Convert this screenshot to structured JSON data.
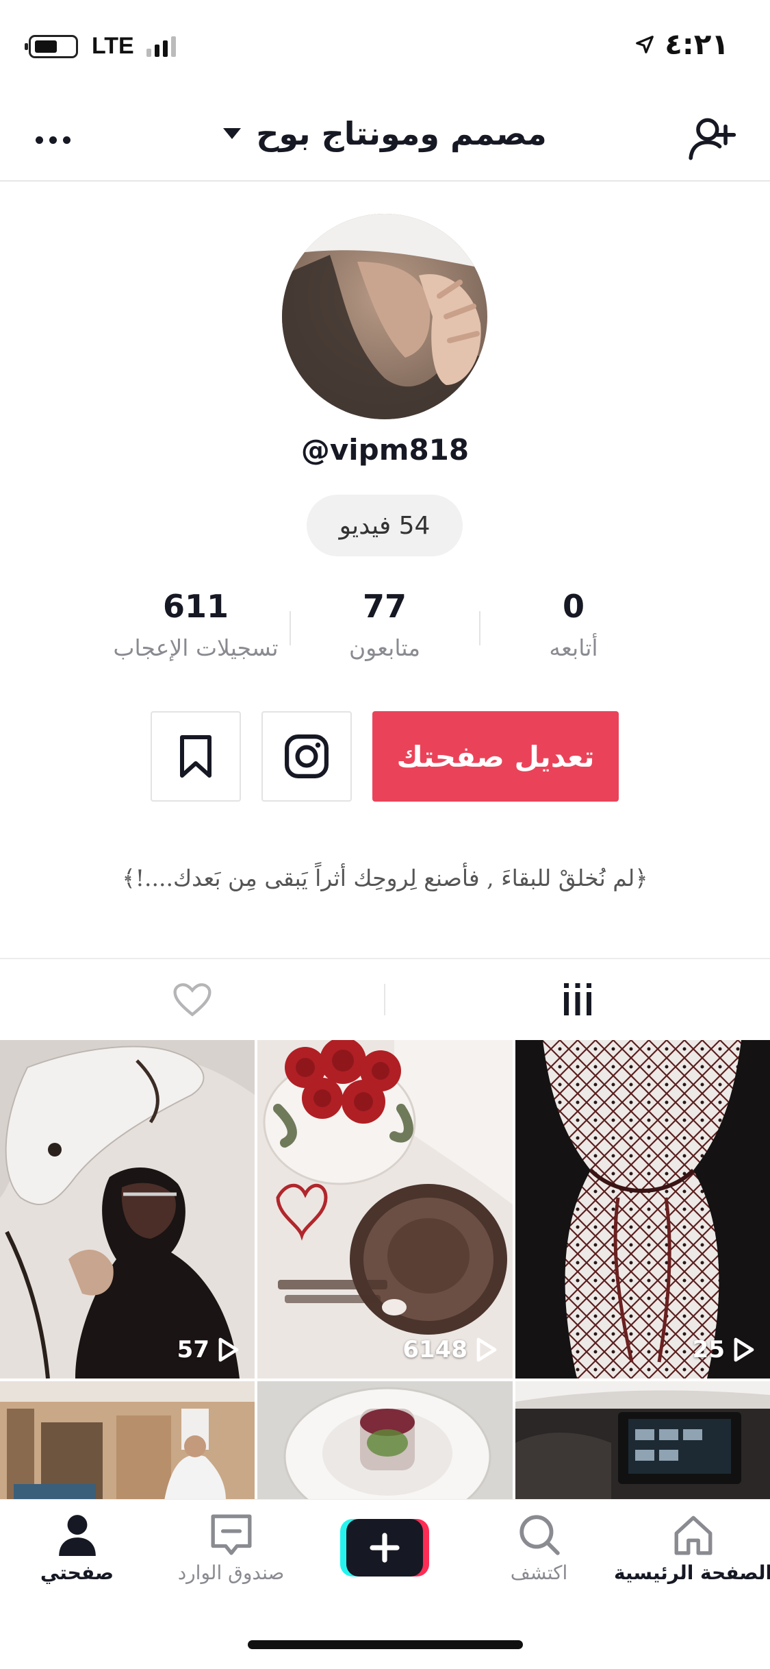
{
  "status_bar": {
    "network": "LTE",
    "time": "٤:٢١"
  },
  "header": {
    "title": "مصمم ومونتاج بوح"
  },
  "profile": {
    "username": "@vipm818",
    "video_count_label": "54 فيديو",
    "stats": [
      {
        "value": "611",
        "label": "تسجيلات الإعجاب"
      },
      {
        "value": "77",
        "label": "متابعون"
      },
      {
        "value": "0",
        "label": "أتابعه"
      }
    ],
    "edit_button": "تعديل صفحتك",
    "bio": "﴿لم نُخلقْ للبقاءَ , فأصنع لِروحِك أثراً يَبقى مِن بَعدك....!﴾"
  },
  "videos": [
    {
      "views": "57"
    },
    {
      "views": "6148"
    },
    {
      "views": "25"
    },
    {
      "views": ""
    },
    {
      "views": ""
    },
    {
      "views": ""
    }
  ],
  "bottom_nav": {
    "profile": "صفحتي",
    "inbox": "صندوق الوارد",
    "discover": "اكتشف",
    "home": "الصفحة الرئيسية"
  },
  "colors": {
    "accent": "#ea4359",
    "text": "#161823",
    "muted": "#8a8b91"
  }
}
